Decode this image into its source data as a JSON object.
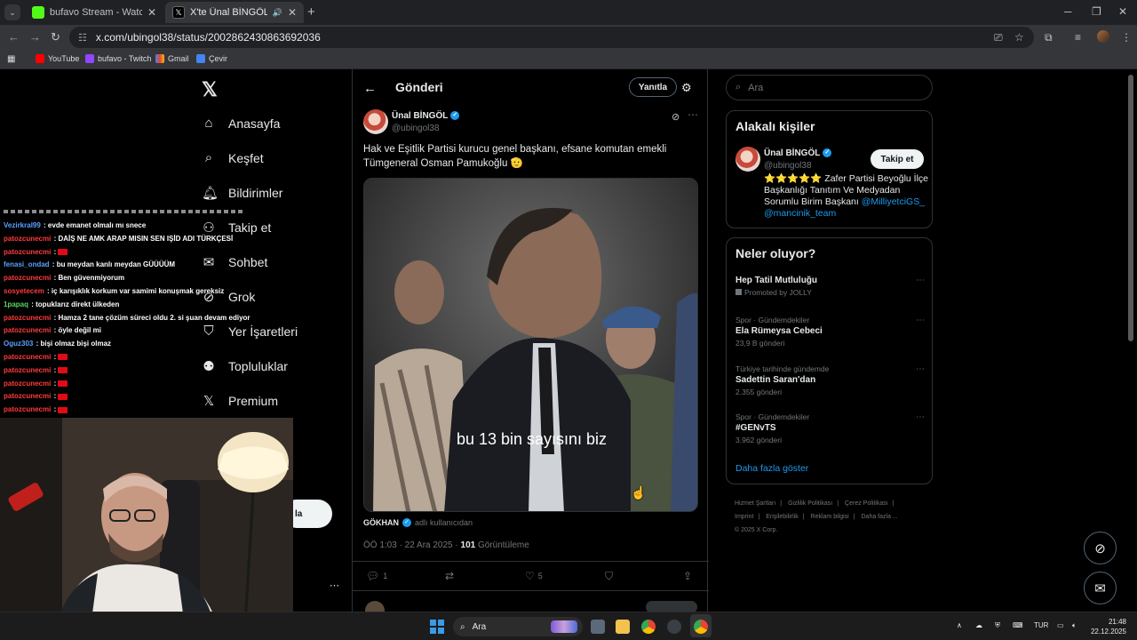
{
  "browser": {
    "tabs": [
      {
        "title": "bufavo Stream - Watch Live on",
        "favicon": "kick-icon",
        "active": false
      },
      {
        "title": "X'te Ünal BİNGÖL: \"Hak ve",
        "favicon": "x-icon",
        "active": true
      }
    ],
    "url": "x.com/ubingol38/status/2002862430863692036",
    "bookmarks": [
      "YouTube",
      "bufavo - Twitch",
      "Gmail",
      "Çevir"
    ]
  },
  "sidebar": {
    "items": [
      {
        "label": "Anasayfa",
        "icon": "home-icon"
      },
      {
        "label": "Keşfet",
        "icon": "search-icon"
      },
      {
        "label": "Bildirimler",
        "icon": "bell-icon"
      },
      {
        "label": "Takip et",
        "icon": "follow-icon"
      },
      {
        "label": "Sohbet",
        "icon": "mail-icon"
      },
      {
        "label": "Grok",
        "icon": "grok-icon"
      },
      {
        "label": "Yer İşaretleri",
        "icon": "bookmark-icon"
      },
      {
        "label": "Topluluklar",
        "icon": "communities-icon"
      },
      {
        "label": "Premium",
        "icon": "x-logo-icon"
      }
    ],
    "post_button_partial": "la"
  },
  "post": {
    "header_title": "Gönderi",
    "reply_button": "Yanıtla",
    "author_name": "Ünal BİNGÖL",
    "author_handle": "@ubingol38",
    "text": "Hak ve Eşitlik Partisi kurucu genel başkanı, efsane komutan emekli Tümgeneral Osman Pamukoğlu 🫡",
    "video_caption": "bu 13 bin sayısını biz",
    "source_name": "GÖKHAN",
    "source_suffix": "adlı kullanıcıdan",
    "time": "ÖÖ 1:03 · 22 Ara 2025 ·",
    "views": "101",
    "views_label": "Görüntüleme",
    "replies": "1",
    "likes": "5"
  },
  "right": {
    "search_placeholder": "Ara",
    "related_title": "Alakalı kişiler",
    "related_name": "Ünal BİNGÖL",
    "related_handle": "@ubingol38",
    "follow_button": "Takip et",
    "bio_text": "⭐⭐⭐⭐⭐ Zafer Partisi Beyoğlu İlçe Başkanlığı Tanıtım Ve Medyadan Sorumlu Birim Başkanı ",
    "bio_link1": "@MilliyetciGS_",
    "bio_link2": "@mancinik_team",
    "trends_title": "Neler oluyor?",
    "trends": [
      {
        "name": "Hep Tatil Mutluluğu",
        "context": "",
        "count": "Promoted by JOLLY"
      },
      {
        "context": "Spor · Gündemdekiler",
        "name": "Ela Rümeysa Cebeci",
        "count": "23,9 B gönderi"
      },
      {
        "context": "Türkiye tarihinde gündemde",
        "name": "Sadettin Saran'dan",
        "count": "2.355 gönderi"
      },
      {
        "context": "Spor · Gündemdekiler",
        "name": "#GENvTS",
        "count": "3.962 gönderi"
      }
    ],
    "show_more": "Daha fazla göster",
    "footer": [
      "Hizmet Şartları",
      "|",
      "Gizlilik Politikası",
      "|",
      "Çerez Politikası",
      "|",
      "Imprint",
      "|",
      "Erişilebilirlik",
      "|",
      "Reklam bilgisi",
      "|",
      "Daha fazla ...",
      "© 2025 X Corp."
    ]
  },
  "chat": [
    {
      "user": "Vezirkral99",
      "color": "#5aa0ff",
      "msg": " : evde emanet olmalı mı snece"
    },
    {
      "user": "patozcunecmi",
      "color": "#ff3b3b",
      "msg": " : DAİŞ NE AMK ARAP MISIN SEN IŞİD ADI TÜRKÇESİ"
    },
    {
      "user": "patozcunecmi",
      "color": "#ff3b3b",
      "msg": " : ",
      "flag": true
    },
    {
      "user": "fenasi_ondad",
      "color": "#5aa0ff",
      "msg": " : bu meydan kanlı meydan GÜÜÜÜM"
    },
    {
      "user": "patozcunecmi",
      "color": "#ff3b3b",
      "msg": " : Ben güvenmiyorum"
    },
    {
      "user": "sosyetecem",
      "color": "#ff3b3b",
      "msg": " : iç karışıklık korkum var samimi konuşmak gereksiz"
    },
    {
      "user": "1papaq",
      "color": "#5cd65c",
      "msg": " : topuklarız direkt ülkeden"
    },
    {
      "user": "patozcunecmi",
      "color": "#ff3b3b",
      "msg": " : Hamza 2 tane çözüm süreci oldu 2. si şuan devam ediyor"
    },
    {
      "user": "patozcunecmi",
      "color": "#ff3b3b",
      "msg": " : öyle değil mi"
    },
    {
      "user": "Oguz303",
      "color": "#5aa0ff",
      "msg": " : bişi olmaz bişi olmaz"
    },
    {
      "user": "patozcunecmi",
      "color": "#ff3b3b",
      "msg": " : ",
      "flag": true
    },
    {
      "user": "patozcunecmi",
      "color": "#ff3b3b",
      "msg": " : ",
      "flag": true
    },
    {
      "user": "patozcunecmi",
      "color": "#ff3b3b",
      "msg": " : ",
      "flag": true
    },
    {
      "user": "patozcunecmi",
      "color": "#ff3b3b",
      "msg": " : ",
      "flag": true
    },
    {
      "user": "patozcunecmi",
      "color": "#ff3b3b",
      "msg": " : ",
      "flag": true
    }
  ],
  "taskbar": {
    "search_placeholder": "Ara",
    "lang": "TUR",
    "time": "21:48",
    "date": "22.12.2025"
  }
}
